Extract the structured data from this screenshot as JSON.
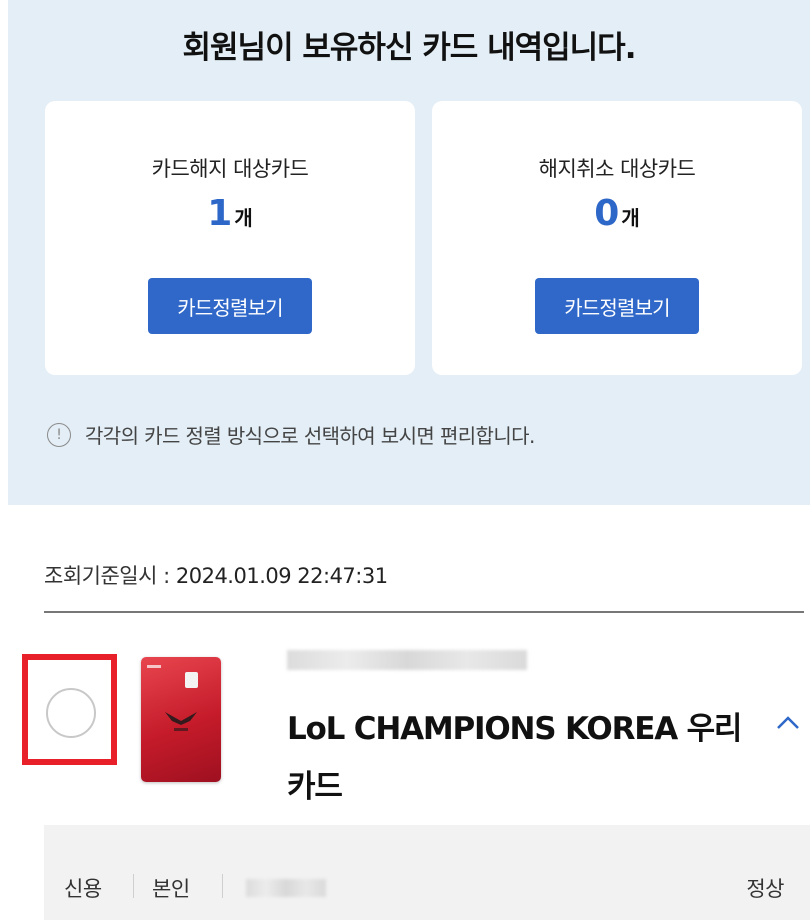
{
  "header": {
    "title": "회원님이 보유하신 카드 내역입니다."
  },
  "summary": [
    {
      "label": "카드해지 대상카드",
      "count": "1",
      "unit": "개",
      "button_label": "카드정렬보기"
    },
    {
      "label": "해지취소 대상카드",
      "count": "0",
      "unit": "개",
      "button_label": "카드정렬보기"
    }
  ],
  "notice": {
    "icon": "info-icon",
    "text": "각각의 카드 정렬 방식으로 선택하여 보시면 편리합니다."
  },
  "query": {
    "label": "조회기준일시 : ",
    "datetime": "2024.01.09 22:47:31"
  },
  "card": {
    "name": "LoL CHAMPIONS KOREA 우리 카드",
    "image_colors": {
      "primary": "#d42a37",
      "dark": "#9e1020"
    },
    "details": {
      "type": "신용",
      "holder": "본인",
      "status": "정상"
    }
  },
  "colors": {
    "accent": "#2f68c9",
    "count_color": "#2d67c8",
    "panel_bg": "#e3eef6",
    "highlight_frame": "#e8202a"
  }
}
